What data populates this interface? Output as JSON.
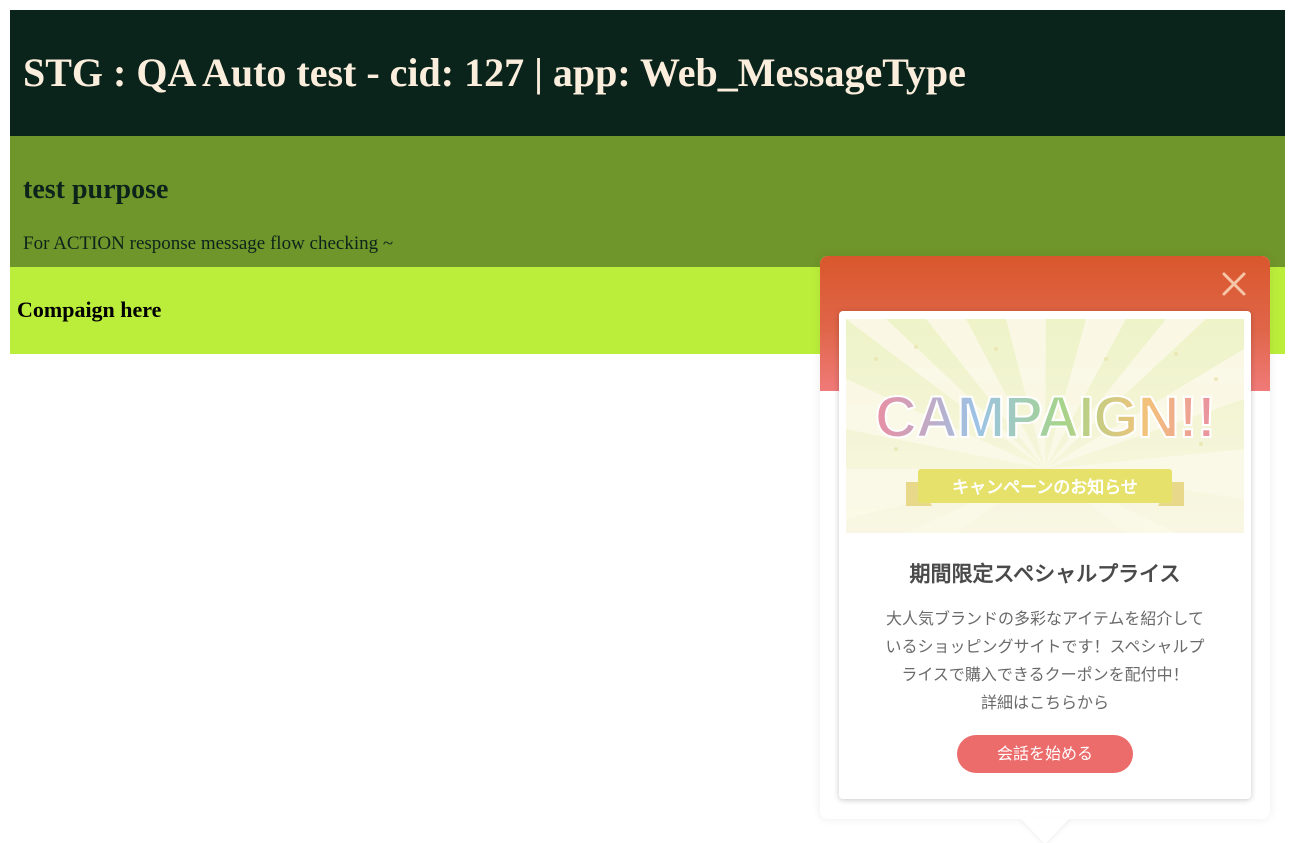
{
  "header": {
    "title": "STG : QA Auto test - cid: 127 | app: Web_MessageType"
  },
  "purpose": {
    "heading": "test purpose",
    "description": "For ACTION response message flow checking ~"
  },
  "campaign_bar": {
    "label": "Compaign here"
  },
  "popup": {
    "banner_title": "CAMPAIGN!!",
    "banner_ribbon": "キャンペーンのお知らせ",
    "title": "期間限定スペシャルプライス",
    "body_line1": "大人気ブランドの多彩なアイテムを紹介して",
    "body_line2": "いるショッピングサイトです！スペシャルプ",
    "body_line3": "ライスで購入できるクーポンを配付中！",
    "body_line4": "詳細はこちらから",
    "cta_label": "会話を始める",
    "icons": {
      "close": "close-icon"
    },
    "colors": {
      "header_gradient_top": "#d9572c",
      "header_gradient_bottom": "#f07a78",
      "cta": "#ec6b6b"
    }
  },
  "colors": {
    "header_bg": "#0a241b",
    "header_text": "#fbeedd",
    "purpose_bg": "#6f962a",
    "campaign_bg": "#bbee3b"
  }
}
